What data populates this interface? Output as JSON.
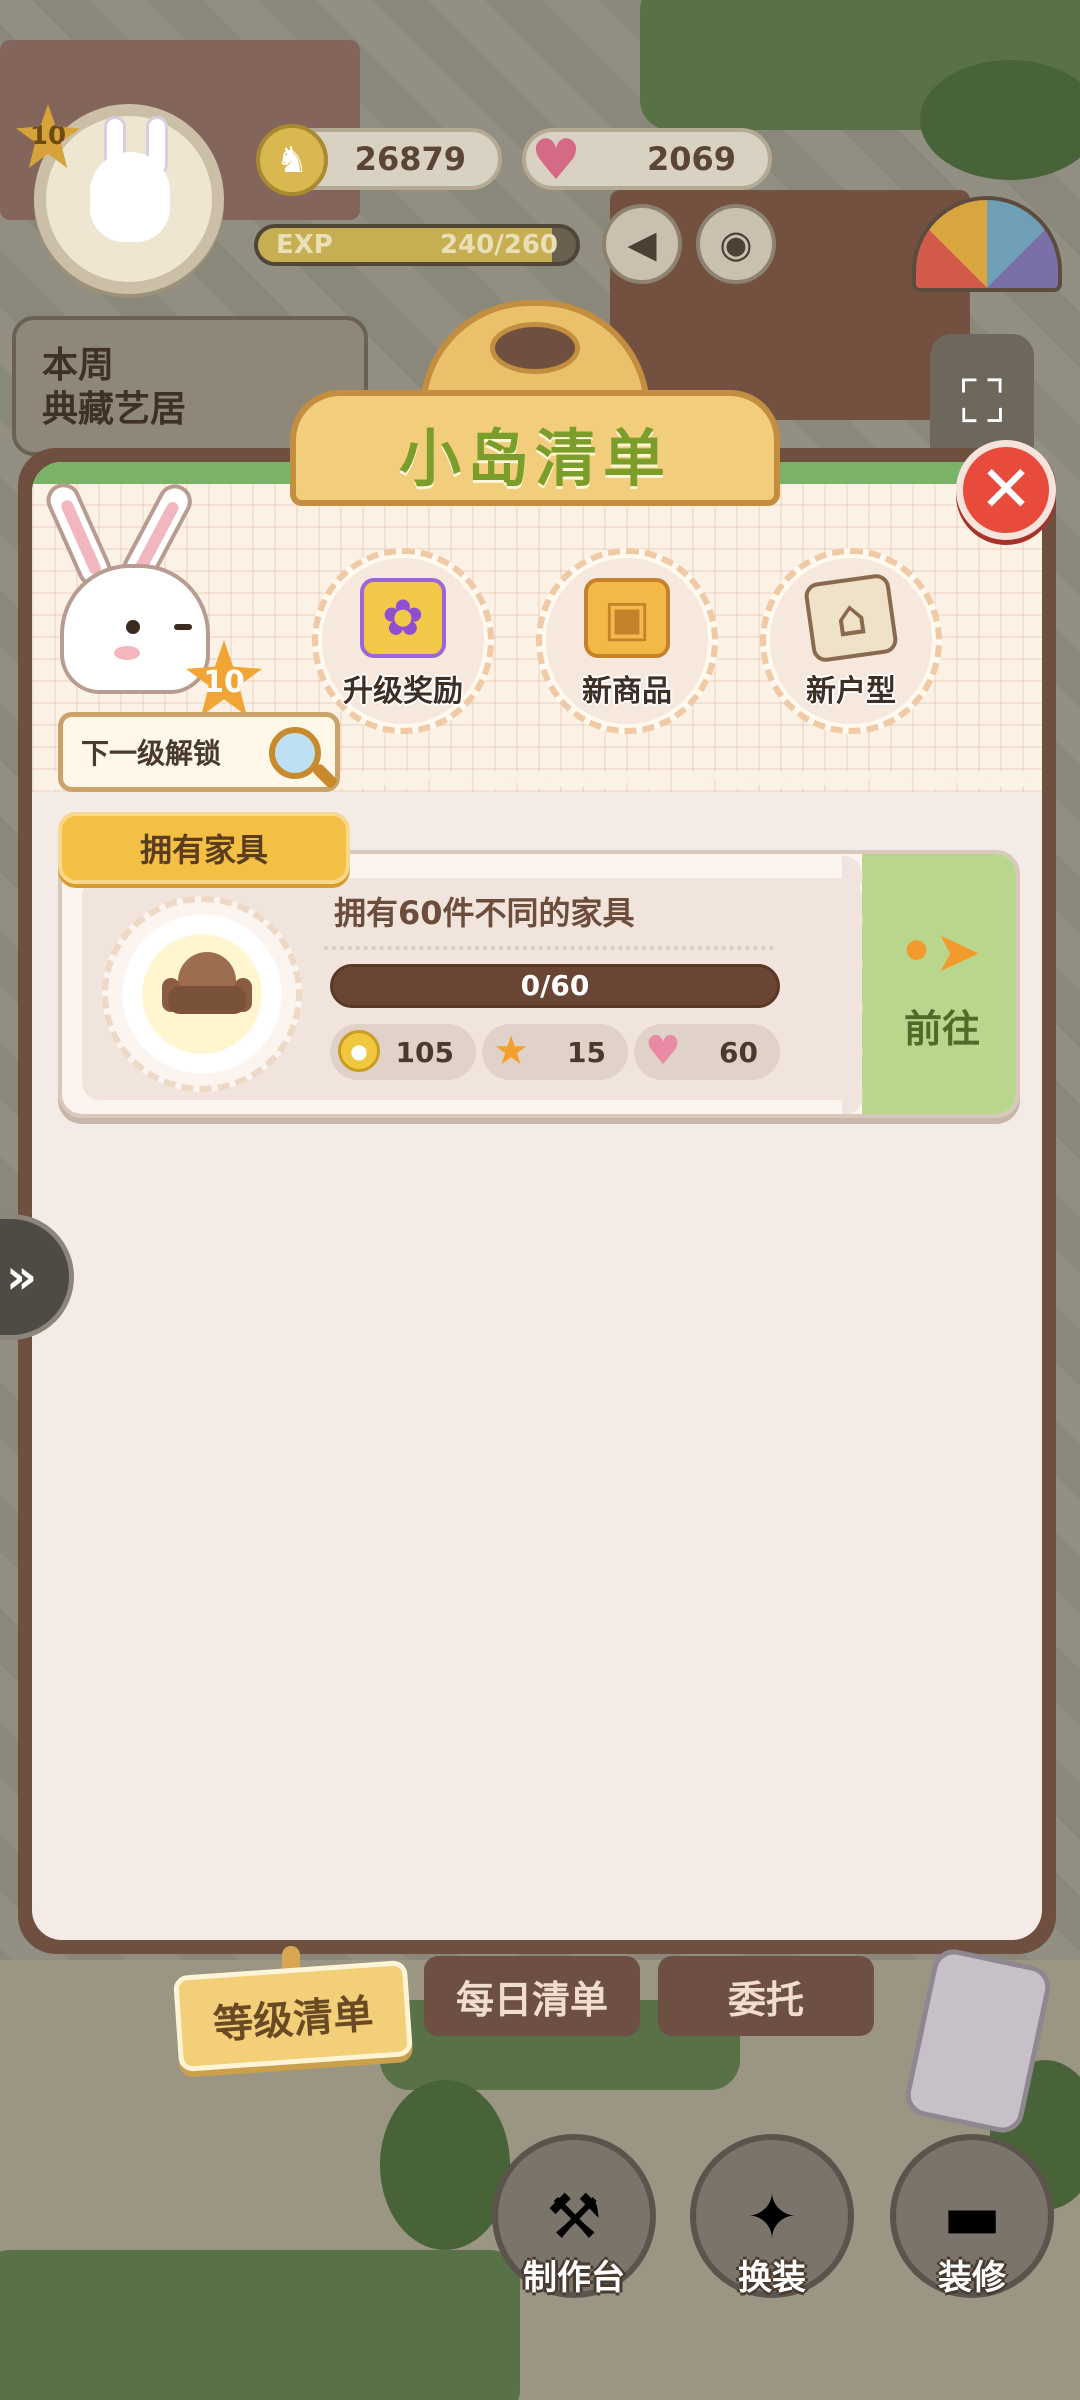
{
  "hud": {
    "level": "10",
    "coins": "26879",
    "hearts": "2069",
    "exp_label": "EXP",
    "exp_value": "240/260",
    "exp_progress": 0.923,
    "weekly_text_line1": "本周",
    "weekly_text_line2": "典藏艺居",
    "icons": {
      "coin": "bunny-coin-icon",
      "heart": "heart-icon",
      "speaker": "speaker-icon",
      "camera": "camera-icon",
      "expand": "expand-icon"
    }
  },
  "modal": {
    "title": "小岛清单",
    "close_icon": "close-icon",
    "bunny_level": "10",
    "unlock_label": "下一级解锁",
    "rewards": [
      {
        "label": "升级奖励",
        "icon": "gift-box-icon"
      },
      {
        "label": "新商品",
        "icon": "handbag-icon"
      },
      {
        "label": "新户型",
        "icon": "blueprint-icon"
      }
    ],
    "section_label": "拥有家具",
    "task": {
      "title": "拥有60件不同的家具",
      "progress_text": "0/60",
      "progress": 0,
      "rewards": [
        {
          "icon": "coin-icon",
          "value": "105"
        },
        {
          "icon": "star-icon",
          "value": "15"
        },
        {
          "icon": "heart-icon",
          "value": "60"
        }
      ],
      "go_label": "前往"
    },
    "tabs": [
      {
        "label": "等级清单",
        "active": true
      },
      {
        "label": "每日清单",
        "active": false
      },
      {
        "label": "委托",
        "active": false
      }
    ]
  },
  "world_buttons": [
    {
      "label": "制作台",
      "icon": "workbench-icon"
    },
    {
      "label": "换装",
      "icon": "outfit-icon"
    },
    {
      "label": "装修",
      "icon": "paint-roller-icon"
    }
  ],
  "colors": {
    "accent_green": "#7b9d2a",
    "close_red": "#e84a3c",
    "tab_gold": "#f2cf78",
    "frame_brown": "#6e4f40"
  }
}
